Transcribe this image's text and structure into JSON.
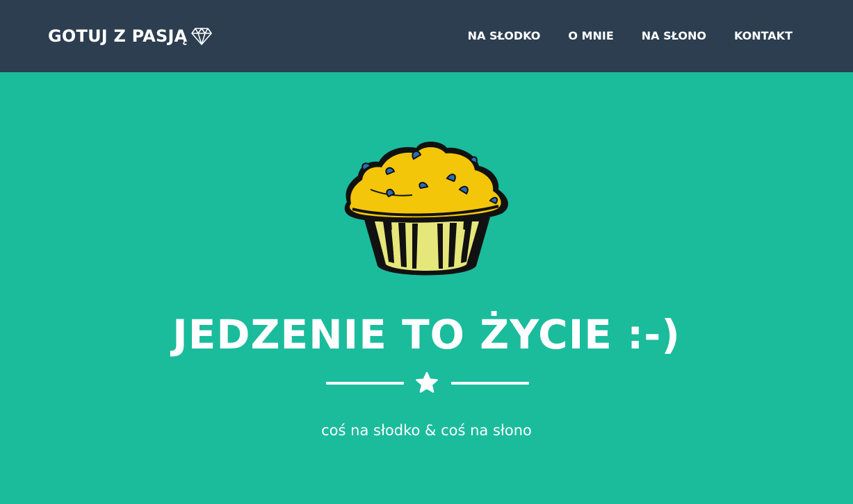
{
  "navbar": {
    "brand": "GOTUJ Z PASJĄ",
    "brand_icon": "diamond-icon",
    "links": [
      {
        "label": "NA SŁODKO"
      },
      {
        "label": "O MNIE"
      },
      {
        "label": "NA SŁONO"
      },
      {
        "label": "KONTAKT"
      }
    ]
  },
  "masthead": {
    "image": "muffin-illustration",
    "title": "JEDZENIE TO ŻYCIE :-)",
    "divider_icon": "star-icon",
    "subtitle": "coś na słodko & coś na słono"
  },
  "colors": {
    "navbar_bg": "#2c3e50",
    "hero_bg": "#1abc9c",
    "text": "#ffffff",
    "muffin_top": "#f3c60a",
    "muffin_wrapper": "#e6e77a",
    "blueberry": "#2e6db4"
  }
}
